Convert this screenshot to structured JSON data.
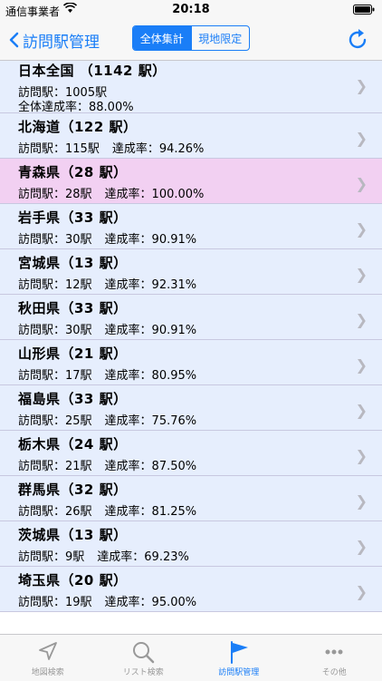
{
  "status_bar": {
    "carrier": "通信事業者",
    "time": "20:18"
  },
  "nav": {
    "back_label": "訪問駅管理",
    "segments": [
      "全体集計",
      "現地限定"
    ],
    "active_segment": 0
  },
  "list": {
    "rows": [
      {
        "title": "日本全国 （1142 駅）",
        "visited": "訪問駅：1005駅",
        "rate": "全体達成率：88.00%"
      },
      {
        "title": "北海道（122 駅）",
        "visited": "訪問駅：115駅",
        "rate": "達成率：94.26%"
      },
      {
        "title": "青森県（28 駅）",
        "visited": "訪問駅：28駅",
        "rate": "達成率：100.00%"
      },
      {
        "title": "岩手県（33 駅）",
        "visited": "訪問駅：30駅",
        "rate": "達成率：90.91%"
      },
      {
        "title": "宮城県（13 駅）",
        "visited": "訪問駅：12駅",
        "rate": "達成率：92.31%"
      },
      {
        "title": "秋田県（33 駅）",
        "visited": "訪問駅：30駅",
        "rate": "達成率：90.91%"
      },
      {
        "title": "山形県（21 駅）",
        "visited": "訪問駅：17駅",
        "rate": "達成率：80.95%"
      },
      {
        "title": "福島県（33 駅）",
        "visited": "訪問駅：25駅",
        "rate": "達成率：75.76%"
      },
      {
        "title": "栃木県（24 駅）",
        "visited": "訪問駅：21駅",
        "rate": "達成率：87.50%"
      },
      {
        "title": "群馬県（32 駅）",
        "visited": "訪問駅：26駅",
        "rate": "達成率：81.25%"
      },
      {
        "title": "茨城県（13 駅）",
        "visited": "訪問駅：9駅",
        "rate": "達成率：69.23%"
      },
      {
        "title": "埼玉県（20 駅）",
        "visited": "訪問駅：19駅",
        "rate": "達成率：95.00%"
      }
    ]
  },
  "tabs": [
    {
      "label": "地図検索",
      "icon": "location-arrow-icon"
    },
    {
      "label": "リスト検索",
      "icon": "search-icon"
    },
    {
      "label": "訪問駅管理",
      "icon": "flag-icon"
    },
    {
      "label": "その他",
      "icon": "more-icon"
    }
  ],
  "colors": {
    "accent": "#1a7ef7",
    "row_bg": "#e6eefd",
    "highlight_bg": "#f2d0f2"
  }
}
